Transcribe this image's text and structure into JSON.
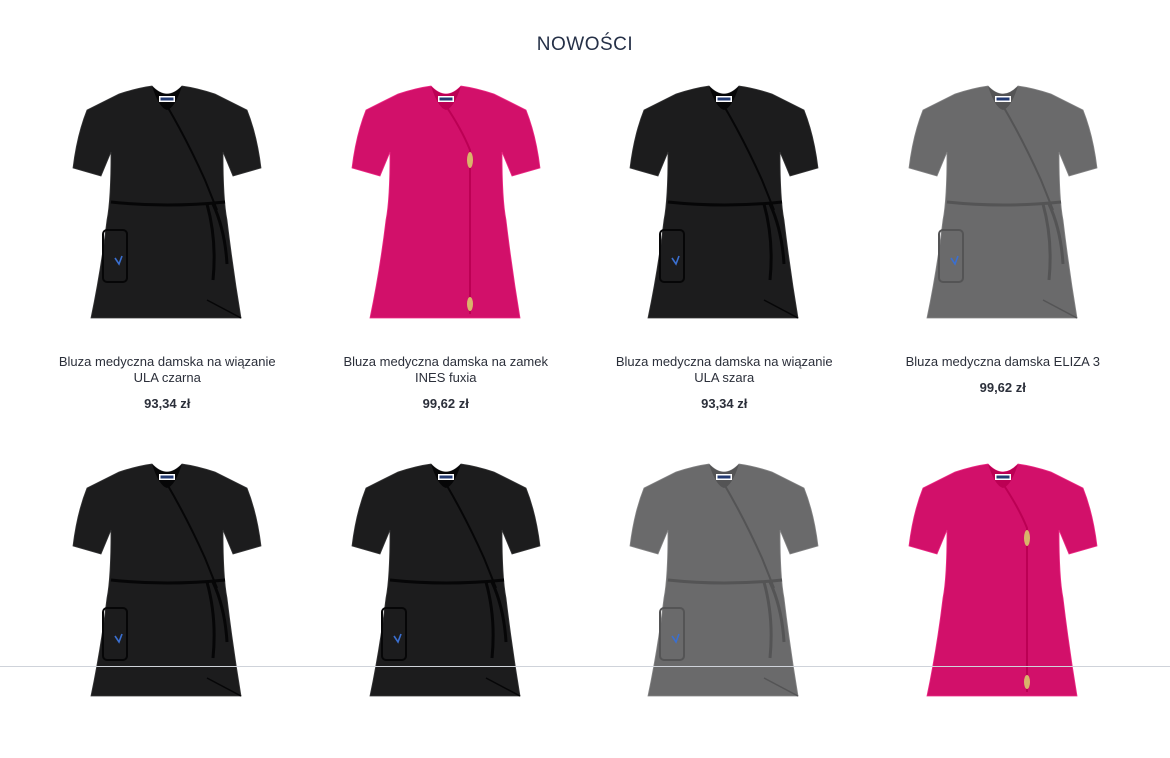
{
  "section": {
    "title": "NOWOŚCI"
  },
  "products": [
    {
      "name": "Bluza medyczna damska na wiązanie ULA czarna",
      "price": "93,34 zł",
      "color": "#1c1c1d",
      "style": "wrap",
      "logo_text": "KRISTE"
    },
    {
      "name": "Bluza medyczna damska na zamek INES fuxia",
      "price": "99,62 zł",
      "color": "#d2106a",
      "style": "zip",
      "logo_text": "KRISTE"
    },
    {
      "name": "Bluza medyczna damska na wiązanie ULA szara",
      "price": "93,34 zł",
      "color": "#1c1c1d",
      "style": "wrap",
      "logo_text": "KRISTE"
    },
    {
      "name": "Bluza medyczna damska ELIZA 3",
      "price": "99,62 zł",
      "color": "#6a6a6b",
      "style": "wrap",
      "logo_text": "KRISTE"
    },
    {
      "color": "#1c1c1d",
      "style": "wrap",
      "logo_text": "KRISTE"
    },
    {
      "color": "#1c1c1d",
      "style": "wrap",
      "logo_text": "KRISTE"
    },
    {
      "color": "#6a6a6b",
      "style": "wrap",
      "logo_text": "KRISTE"
    },
    {
      "color": "#d2106a",
      "style": "zip",
      "logo_text": "KRISTE"
    }
  ]
}
